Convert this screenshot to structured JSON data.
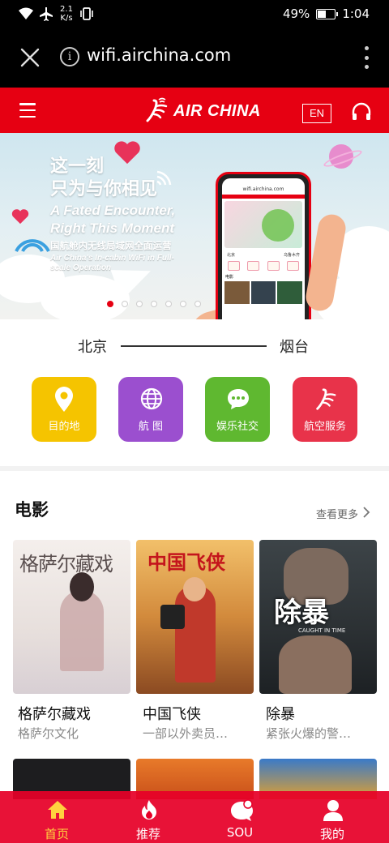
{
  "status_bar": {
    "net_speed": "2.1",
    "net_speed_unit": "K/s",
    "battery_percent": "49%",
    "battery_level": 0.49,
    "time": "1:04"
  },
  "browser": {
    "url": "wifi.airchina.com"
  },
  "header": {
    "logo_text": "AIR CHINA",
    "lang_button": "EN"
  },
  "banner": {
    "cn_line1": "这一刻",
    "cn_line2": "只为与你相见",
    "en_line1": "A Fated Encounter,",
    "en_line2": "Right This Moment",
    "cn_sub": "国航舱内无线局域网全面运营",
    "en_sub": "Air China's In-cabin WiFi in Full-scale Operation",
    "phone_url": "wifi.airchina.com",
    "phone_route_from": "北京",
    "phone_route_to": "乌鲁木齐",
    "phone_section": "电影",
    "dot_count": 7,
    "active_dot": 0
  },
  "route": {
    "from": "北京",
    "to": "烟台"
  },
  "quick_actions": [
    {
      "label": "目的地",
      "icon": "location-pin-icon",
      "color": "#f5c400"
    },
    {
      "label": "航 图",
      "icon": "globe-icon",
      "color": "#9b4fcf"
    },
    {
      "label": "娱乐社交",
      "icon": "chat-bubble-icon",
      "color": "#5fb830"
    },
    {
      "label": "航空服务",
      "icon": "air-china-logo-icon",
      "color": "#e8334a"
    }
  ],
  "movies": {
    "title": "电影",
    "more_label": "查看更多",
    "items": [
      {
        "title": "格萨尔藏戏",
        "subtitle": "格萨尔文化",
        "poster_text": "格萨尔藏戏"
      },
      {
        "title": "中国飞侠",
        "subtitle": "一部以外卖员…",
        "poster_text": "中国飞侠"
      },
      {
        "title": "除暴",
        "subtitle": "紧张火爆的警…",
        "poster_text": "除暴",
        "poster_caption": "CAUGHT IN TIME"
      }
    ]
  },
  "bottom_nav": [
    {
      "label": "首页",
      "icon": "home-icon",
      "active": true
    },
    {
      "label": "推荐",
      "icon": "flame-icon",
      "active": false
    },
    {
      "label": "SOU",
      "icon": "search-chat-icon",
      "active": false
    },
    {
      "label": "我的",
      "icon": "person-icon",
      "active": false
    }
  ],
  "colors": {
    "brand_red": "#e60012",
    "nav_active": "#ffd23f"
  }
}
